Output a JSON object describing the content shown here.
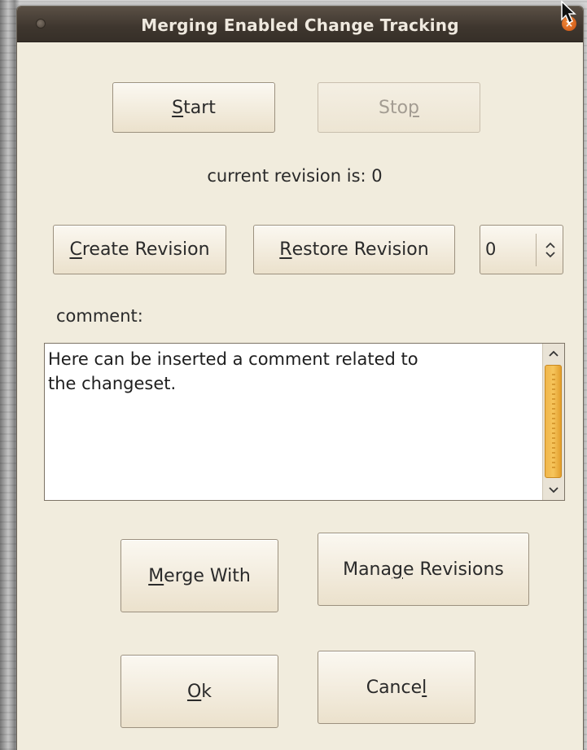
{
  "window": {
    "title": "Merging Enabled Change Tracking"
  },
  "controls": {
    "start": {
      "before": "",
      "mnemonic": "S",
      "after": "tart"
    },
    "stop": {
      "before": "Sto",
      "mnemonic": "p",
      "after": ""
    },
    "status_text": "current revision is: 0",
    "create_revision": {
      "before": "",
      "mnemonic": "C",
      "after": "reate Revision"
    },
    "restore_revision": {
      "before": "",
      "mnemonic": "R",
      "after": "estore Revision"
    },
    "revision_spin_value": "0",
    "comment_label": "comment:",
    "comment_text": "Here can be inserted a comment related to\nthe changeset.",
    "merge_with": {
      "before": "",
      "mnemonic": "M",
      "after": "erge With"
    },
    "manage_revisions": {
      "before": "Mana",
      "mnemonic": "g",
      "after": "e Revisions"
    },
    "ok": {
      "before": "",
      "mnemonic": "O",
      "after": "k"
    },
    "cancel": {
      "before": "Cance",
      "mnemonic": "l",
      "after": ""
    }
  },
  "icons": {
    "window_menu": "window-menu-icon",
    "close": "close-icon",
    "spin_arrows": "spin-arrows-icon",
    "scroll_up": "scroll-up-icon",
    "scroll_down": "scroll-down-icon",
    "pointer": "mouse-pointer-icon"
  },
  "colors": {
    "titlebar": "#3e362e",
    "dialog_bg": "#f1ecdd",
    "scroll_thumb": "#f0b64a"
  }
}
